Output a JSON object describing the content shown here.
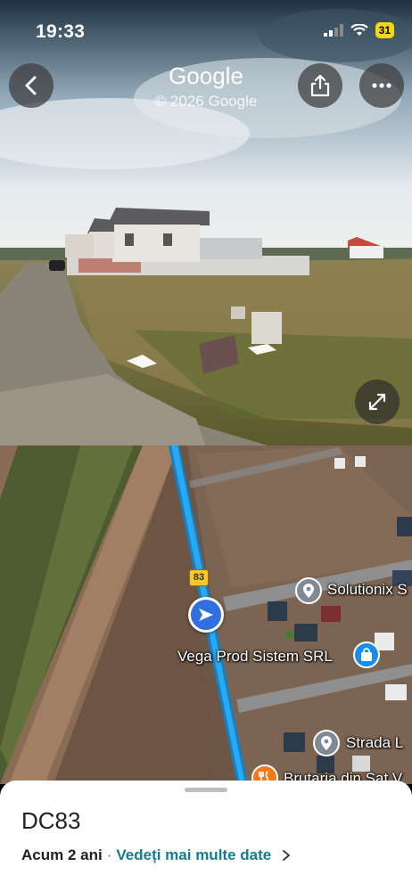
{
  "status_bar": {
    "time": "19:33",
    "battery": "31"
  },
  "street_view": {
    "brand": "Google",
    "copyright": "© 2026 Google",
    "icons": {
      "back": "chevron-left-icon",
      "share": "share-icon",
      "more": "more-horizontal-icon",
      "expand": "expand-icon"
    }
  },
  "map": {
    "road_number": "83",
    "pois": [
      {
        "name": "Solutionix S",
        "icon": "map-pin-icon",
        "color": "#7f8a94"
      },
      {
        "name": "Vega Prod Sistem SRL",
        "icon": "shopping-bag-icon",
        "color": "#1a8de8"
      },
      {
        "name": "Strada L",
        "icon": "map-pin-icon",
        "color": "#7f8a94"
      },
      {
        "name": "Brutaria din Sat V",
        "icon": "restaurant-icon",
        "color": "#f07a1a"
      }
    ],
    "route_color": "#29a9f2"
  },
  "sheet": {
    "title": "DC83",
    "age": "Acum 2 ani",
    "separator": "·",
    "link": "Vedeți mai multe date",
    "accent_color": "#137e8c"
  }
}
